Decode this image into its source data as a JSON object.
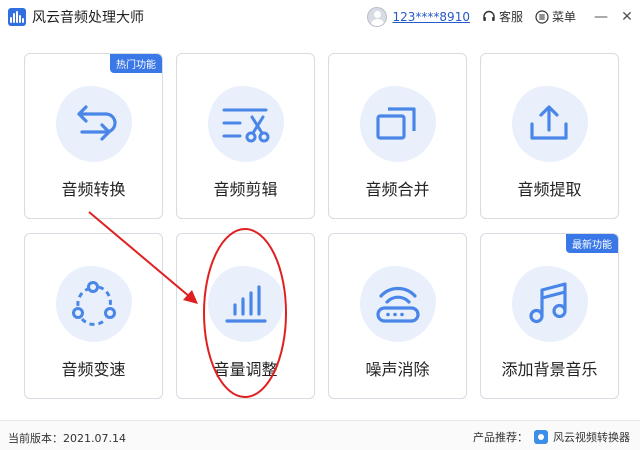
{
  "window": {
    "title": "风云音频处理大师",
    "account": "123****8910",
    "service_label": "客服",
    "menu_label": "菜单",
    "minimize_glyph": "—",
    "close_glyph": "✕"
  },
  "cards": [
    {
      "label": "音频转换",
      "badge": "热门功能",
      "icon": "convert-icon"
    },
    {
      "label": "音频剪辑",
      "badge": "",
      "icon": "scissors-icon"
    },
    {
      "label": "音频合并",
      "badge": "",
      "icon": "merge-icon"
    },
    {
      "label": "音频提取",
      "badge": "",
      "icon": "extract-icon"
    },
    {
      "label": "音频变速",
      "badge": "",
      "icon": "speed-icon"
    },
    {
      "label": "音量调整",
      "badge": "",
      "icon": "volume-bars-icon"
    },
    {
      "label": "噪声消除",
      "badge": "",
      "icon": "noise-removal-icon"
    },
    {
      "label": "添加背景音乐",
      "badge": "最新功能",
      "icon": "music-note-icon"
    }
  ],
  "status": {
    "version": "当前版本：2021.07.14",
    "recommend_label": "产品推荐：",
    "recommend_product": "风云视频转换器"
  },
  "colors": {
    "accent": "#3b78e7",
    "icon_blue": "#4a86e8",
    "icon_bg": "#e9f0fc",
    "annotation_red": "#e02020"
  }
}
